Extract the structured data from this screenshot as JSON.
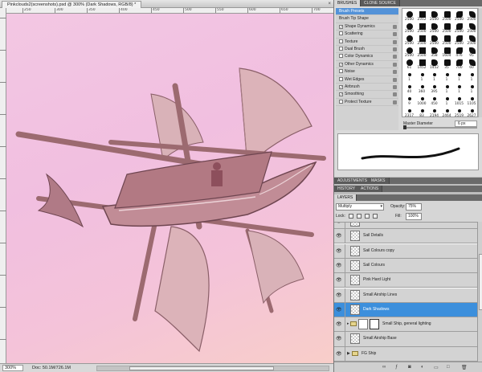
{
  "document": {
    "tab_title": "Pinkclouds2(screenshots).psd @ 300% (Dark Shadows, RGB/8) *",
    "close": "×",
    "ruler_ticks": [
      "250",
      "300",
      "350",
      "400",
      "450",
      "500",
      "550",
      "600",
      "650",
      "700"
    ]
  },
  "status_bar": {
    "zoom": "300%",
    "doc_info": "Doc: 50.1M/726.1M"
  },
  "brushes_panel": {
    "tabs": [
      "BRUSHES",
      "CLONE SOURCE"
    ],
    "list": [
      {
        "label": "Brush Presets",
        "type": "head"
      },
      {
        "label": "Brush Tip Shape",
        "type": "plain"
      },
      {
        "label": "Shape Dynamics",
        "checked": true
      },
      {
        "label": "Scattering",
        "checked": false
      },
      {
        "label": "Texture",
        "checked": false
      },
      {
        "label": "Dual Brush",
        "checked": false
      },
      {
        "label": "Color Dynamics",
        "checked": false
      },
      {
        "label": "Other Dynamics",
        "checked": true
      },
      {
        "label": "Noise",
        "checked": false
      },
      {
        "label": "Wet Edges",
        "checked": false
      },
      {
        "label": "Airbrush",
        "checked": true
      },
      {
        "label": "Smoothing",
        "checked": true
      },
      {
        "label": "Protect Texture",
        "checked": false
      }
    ],
    "brush_sizes": [
      "2500",
      "2312",
      "2500",
      "2500",
      "2500",
      "2500",
      "2500",
      "2500",
      "2500",
      "2500",
      "2500",
      "2500",
      "2500",
      "2500",
      "2500",
      "2500",
      "2500",
      "2500",
      "2500",
      "2500",
      "358",
      "1604",
      "476",
      "95",
      "61",
      "1452",
      "1452",
      "35",
      "700",
      "60",
      "1",
      "1",
      "1",
      "1",
      "1",
      "1",
      "40",
      "360",
      "395",
      "1",
      "1",
      "1",
      "9",
      "1000",
      "450",
      "1",
      "1015",
      "1105",
      "2317",
      "83",
      "2194",
      "2464",
      "2519",
      "2627"
    ],
    "check": "✓",
    "master_diameter_label": "Master Diameter",
    "master_diameter_value": "6 px"
  },
  "adjustments_tabs": [
    "ADJUSTMENTS",
    "MASKS"
  ],
  "history_tabs": [
    "HISTORY",
    "ACTIONS"
  ],
  "layers_panel": {
    "tab": "LAYERS",
    "blend_mode": "Multiply",
    "opacity_label": "Opacity:",
    "opacity": "75%",
    "lock_label": "Lock:",
    "fill_label": "Fill:",
    "fill": "100%",
    "layers": [
      {
        "name": "",
        "kind": "normal",
        "active": false
      },
      {
        "name": "Sail Details",
        "kind": "normal",
        "active": false
      },
      {
        "name": "Sail Colours copy",
        "kind": "normal",
        "active": false
      },
      {
        "name": "Sail Colours",
        "kind": "normal",
        "active": false
      },
      {
        "name": "Pink Hard Light",
        "kind": "normal",
        "active": false
      },
      {
        "name": "Small Airship Lines",
        "kind": "normal",
        "active": false
      },
      {
        "name": "Dark Shadows",
        "kind": "normal",
        "active": true
      },
      {
        "name": "Small Ship, general lighting",
        "kind": "adjustment",
        "active": false
      },
      {
        "name": "Small Airship Base",
        "kind": "normal",
        "active": false
      },
      {
        "name": "FG Ship",
        "kind": "group",
        "active": false
      }
    ]
  },
  "colors": {
    "accent": "#3c8fdc",
    "canvas_pink": "#f2c2e0",
    "panel_bg": "#d6d6d6"
  }
}
